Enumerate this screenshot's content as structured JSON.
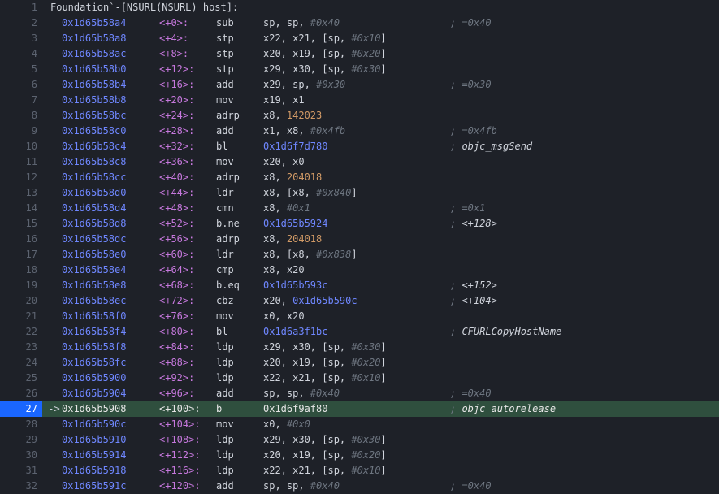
{
  "header": {
    "line_no": 1,
    "text": "Foundation`-[NSURL(NSURL) host]:"
  },
  "current_line": 27,
  "lines": [
    {
      "n": 2,
      "addr": "0x1d65b58a4",
      "off": "<+0>:",
      "mnem": "sub",
      "args": [
        {
          "t": "reg",
          "v": "sp, sp, "
        },
        {
          "t": "imm",
          "v": "#0x40"
        }
      ],
      "cmt": [
        {
          "t": "p",
          "v": "; "
        },
        {
          "t": "imm",
          "v": "=0x40"
        }
      ]
    },
    {
      "n": 3,
      "addr": "0x1d65b58a8",
      "off": "<+4>:",
      "mnem": "stp",
      "args": [
        {
          "t": "reg",
          "v": "x22, x21, [sp, "
        },
        {
          "t": "imm",
          "v": "#0x10"
        },
        {
          "t": "reg",
          "v": "]"
        }
      ]
    },
    {
      "n": 4,
      "addr": "0x1d65b58ac",
      "off": "<+8>:",
      "mnem": "stp",
      "args": [
        {
          "t": "reg",
          "v": "x20, x19, [sp, "
        },
        {
          "t": "imm",
          "v": "#0x20"
        },
        {
          "t": "reg",
          "v": "]"
        }
      ]
    },
    {
      "n": 5,
      "addr": "0x1d65b58b0",
      "off": "<+12>:",
      "mnem": "stp",
      "args": [
        {
          "t": "reg",
          "v": "x29, x30, [sp, "
        },
        {
          "t": "imm",
          "v": "#0x30"
        },
        {
          "t": "reg",
          "v": "]"
        }
      ]
    },
    {
      "n": 6,
      "addr": "0x1d65b58b4",
      "off": "<+16>:",
      "mnem": "add",
      "args": [
        {
          "t": "reg",
          "v": "x29, sp, "
        },
        {
          "t": "imm",
          "v": "#0x30"
        }
      ],
      "cmt": [
        {
          "t": "p",
          "v": "; "
        },
        {
          "t": "imm",
          "v": "=0x30"
        }
      ]
    },
    {
      "n": 7,
      "addr": "0x1d65b58b8",
      "off": "<+20>:",
      "mnem": "mov",
      "args": [
        {
          "t": "reg",
          "v": "x19, x1"
        }
      ]
    },
    {
      "n": 8,
      "addr": "0x1d65b58bc",
      "off": "<+24>:",
      "mnem": "adrp",
      "args": [
        {
          "t": "reg",
          "v": "x8, "
        },
        {
          "t": "num",
          "v": "142023"
        }
      ]
    },
    {
      "n": 9,
      "addr": "0x1d65b58c0",
      "off": "<+28>:",
      "mnem": "add",
      "args": [
        {
          "t": "reg",
          "v": "x1, x8, "
        },
        {
          "t": "imm",
          "v": "#0x4fb"
        }
      ],
      "cmt": [
        {
          "t": "p",
          "v": "; "
        },
        {
          "t": "imm",
          "v": "=0x4fb"
        }
      ]
    },
    {
      "n": 10,
      "addr": "0x1d65b58c4",
      "off": "<+32>:",
      "mnem": "bl",
      "args": [
        {
          "t": "addr",
          "v": "0x1d6f7d780"
        }
      ],
      "cmt": [
        {
          "t": "p",
          "v": "; "
        },
        {
          "t": "sym",
          "v": "objc_msgSend"
        }
      ]
    },
    {
      "n": 11,
      "addr": "0x1d65b58c8",
      "off": "<+36>:",
      "mnem": "mov",
      "args": [
        {
          "t": "reg",
          "v": "x20, x0"
        }
      ]
    },
    {
      "n": 12,
      "addr": "0x1d65b58cc",
      "off": "<+40>:",
      "mnem": "adrp",
      "args": [
        {
          "t": "reg",
          "v": "x8, "
        },
        {
          "t": "num",
          "v": "204018"
        }
      ]
    },
    {
      "n": 13,
      "addr": "0x1d65b58d0",
      "off": "<+44>:",
      "mnem": "ldr",
      "args": [
        {
          "t": "reg",
          "v": "x8, [x8, "
        },
        {
          "t": "imm",
          "v": "#0x840"
        },
        {
          "t": "reg",
          "v": "]"
        }
      ]
    },
    {
      "n": 14,
      "addr": "0x1d65b58d4",
      "off": "<+48>:",
      "mnem": "cmn",
      "args": [
        {
          "t": "reg",
          "v": "x8, "
        },
        {
          "t": "imm",
          "v": "#0x1"
        }
      ],
      "cmt": [
        {
          "t": "p",
          "v": "; "
        },
        {
          "t": "imm",
          "v": "=0x1"
        }
      ]
    },
    {
      "n": 15,
      "addr": "0x1d65b58d8",
      "off": "<+52>:",
      "mnem": "b.ne",
      "args": [
        {
          "t": "addr",
          "v": "0x1d65b5924"
        }
      ],
      "cmt": [
        {
          "t": "p",
          "v": "; "
        },
        {
          "t": "sym",
          "v": "<+128>"
        }
      ]
    },
    {
      "n": 16,
      "addr": "0x1d65b58dc",
      "off": "<+56>:",
      "mnem": "adrp",
      "args": [
        {
          "t": "reg",
          "v": "x8, "
        },
        {
          "t": "num",
          "v": "204018"
        }
      ]
    },
    {
      "n": 17,
      "addr": "0x1d65b58e0",
      "off": "<+60>:",
      "mnem": "ldr",
      "args": [
        {
          "t": "reg",
          "v": "x8, [x8, "
        },
        {
          "t": "imm",
          "v": "#0x838"
        },
        {
          "t": "reg",
          "v": "]"
        }
      ]
    },
    {
      "n": 18,
      "addr": "0x1d65b58e4",
      "off": "<+64>:",
      "mnem": "cmp",
      "args": [
        {
          "t": "reg",
          "v": "x8, x20"
        }
      ]
    },
    {
      "n": 19,
      "addr": "0x1d65b58e8",
      "off": "<+68>:",
      "mnem": "b.eq",
      "args": [
        {
          "t": "addr",
          "v": "0x1d65b593c"
        }
      ],
      "cmt": [
        {
          "t": "p",
          "v": "; "
        },
        {
          "t": "sym",
          "v": "<+152>"
        }
      ]
    },
    {
      "n": 20,
      "addr": "0x1d65b58ec",
      "off": "<+72>:",
      "mnem": "cbz",
      "args": [
        {
          "t": "reg",
          "v": "x20, "
        },
        {
          "t": "addr",
          "v": "0x1d65b590c"
        }
      ],
      "cmt": [
        {
          "t": "p",
          "v": "; "
        },
        {
          "t": "sym",
          "v": "<+104>"
        }
      ]
    },
    {
      "n": 21,
      "addr": "0x1d65b58f0",
      "off": "<+76>:",
      "mnem": "mov",
      "args": [
        {
          "t": "reg",
          "v": "x0, x20"
        }
      ]
    },
    {
      "n": 22,
      "addr": "0x1d65b58f4",
      "off": "<+80>:",
      "mnem": "bl",
      "args": [
        {
          "t": "addr",
          "v": "0x1d6a3f1bc"
        }
      ],
      "cmt": [
        {
          "t": "p",
          "v": "; "
        },
        {
          "t": "sym",
          "v": "CFURLCopyHostName"
        }
      ]
    },
    {
      "n": 23,
      "addr": "0x1d65b58f8",
      "off": "<+84>:",
      "mnem": "ldp",
      "args": [
        {
          "t": "reg",
          "v": "x29, x30, [sp, "
        },
        {
          "t": "imm",
          "v": "#0x30"
        },
        {
          "t": "reg",
          "v": "]"
        }
      ]
    },
    {
      "n": 24,
      "addr": "0x1d65b58fc",
      "off": "<+88>:",
      "mnem": "ldp",
      "args": [
        {
          "t": "reg",
          "v": "x20, x19, [sp, "
        },
        {
          "t": "imm",
          "v": "#0x20"
        },
        {
          "t": "reg",
          "v": "]"
        }
      ]
    },
    {
      "n": 25,
      "addr": "0x1d65b5900",
      "off": "<+92>:",
      "mnem": "ldp",
      "args": [
        {
          "t": "reg",
          "v": "x22, x21, [sp, "
        },
        {
          "t": "imm",
          "v": "#0x10"
        },
        {
          "t": "reg",
          "v": "]"
        }
      ]
    },
    {
      "n": 26,
      "addr": "0x1d65b5904",
      "off": "<+96>:",
      "mnem": "add",
      "args": [
        {
          "t": "reg",
          "v": "sp, sp, "
        },
        {
          "t": "imm",
          "v": "#0x40"
        }
      ],
      "cmt": [
        {
          "t": "p",
          "v": "; "
        },
        {
          "t": "imm",
          "v": "=0x40"
        }
      ]
    },
    {
      "n": 27,
      "addr": "0x1d65b5908",
      "off": "<+100>:",
      "mnem": "b",
      "args": [
        {
          "t": "addr",
          "v": "0x1d6f9af80"
        }
      ],
      "cmt": [
        {
          "t": "p",
          "v": "; "
        },
        {
          "t": "sym",
          "v": "objc_autorelease"
        }
      ]
    },
    {
      "n": 28,
      "addr": "0x1d65b590c",
      "off": "<+104>:",
      "mnem": "mov",
      "args": [
        {
          "t": "reg",
          "v": "x0, "
        },
        {
          "t": "imm",
          "v": "#0x0"
        }
      ]
    },
    {
      "n": 29,
      "addr": "0x1d65b5910",
      "off": "<+108>:",
      "mnem": "ldp",
      "args": [
        {
          "t": "reg",
          "v": "x29, x30, [sp, "
        },
        {
          "t": "imm",
          "v": "#0x30"
        },
        {
          "t": "reg",
          "v": "]"
        }
      ]
    },
    {
      "n": 30,
      "addr": "0x1d65b5914",
      "off": "<+112>:",
      "mnem": "ldp",
      "args": [
        {
          "t": "reg",
          "v": "x20, x19, [sp, "
        },
        {
          "t": "imm",
          "v": "#0x20"
        },
        {
          "t": "reg",
          "v": "]"
        }
      ]
    },
    {
      "n": 31,
      "addr": "0x1d65b5918",
      "off": "<+116>:",
      "mnem": "ldp",
      "args": [
        {
          "t": "reg",
          "v": "x22, x21, [sp, "
        },
        {
          "t": "imm",
          "v": "#0x10"
        },
        {
          "t": "reg",
          "v": "]"
        }
      ]
    },
    {
      "n": 32,
      "addr": "0x1d65b591c",
      "off": "<+120>:",
      "mnem": "add",
      "args": [
        {
          "t": "reg",
          "v": "sp, sp, "
        },
        {
          "t": "imm",
          "v": "#0x40"
        }
      ],
      "cmt": [
        {
          "t": "p",
          "v": "; "
        },
        {
          "t": "imm",
          "v": "=0x40"
        }
      ]
    }
  ]
}
